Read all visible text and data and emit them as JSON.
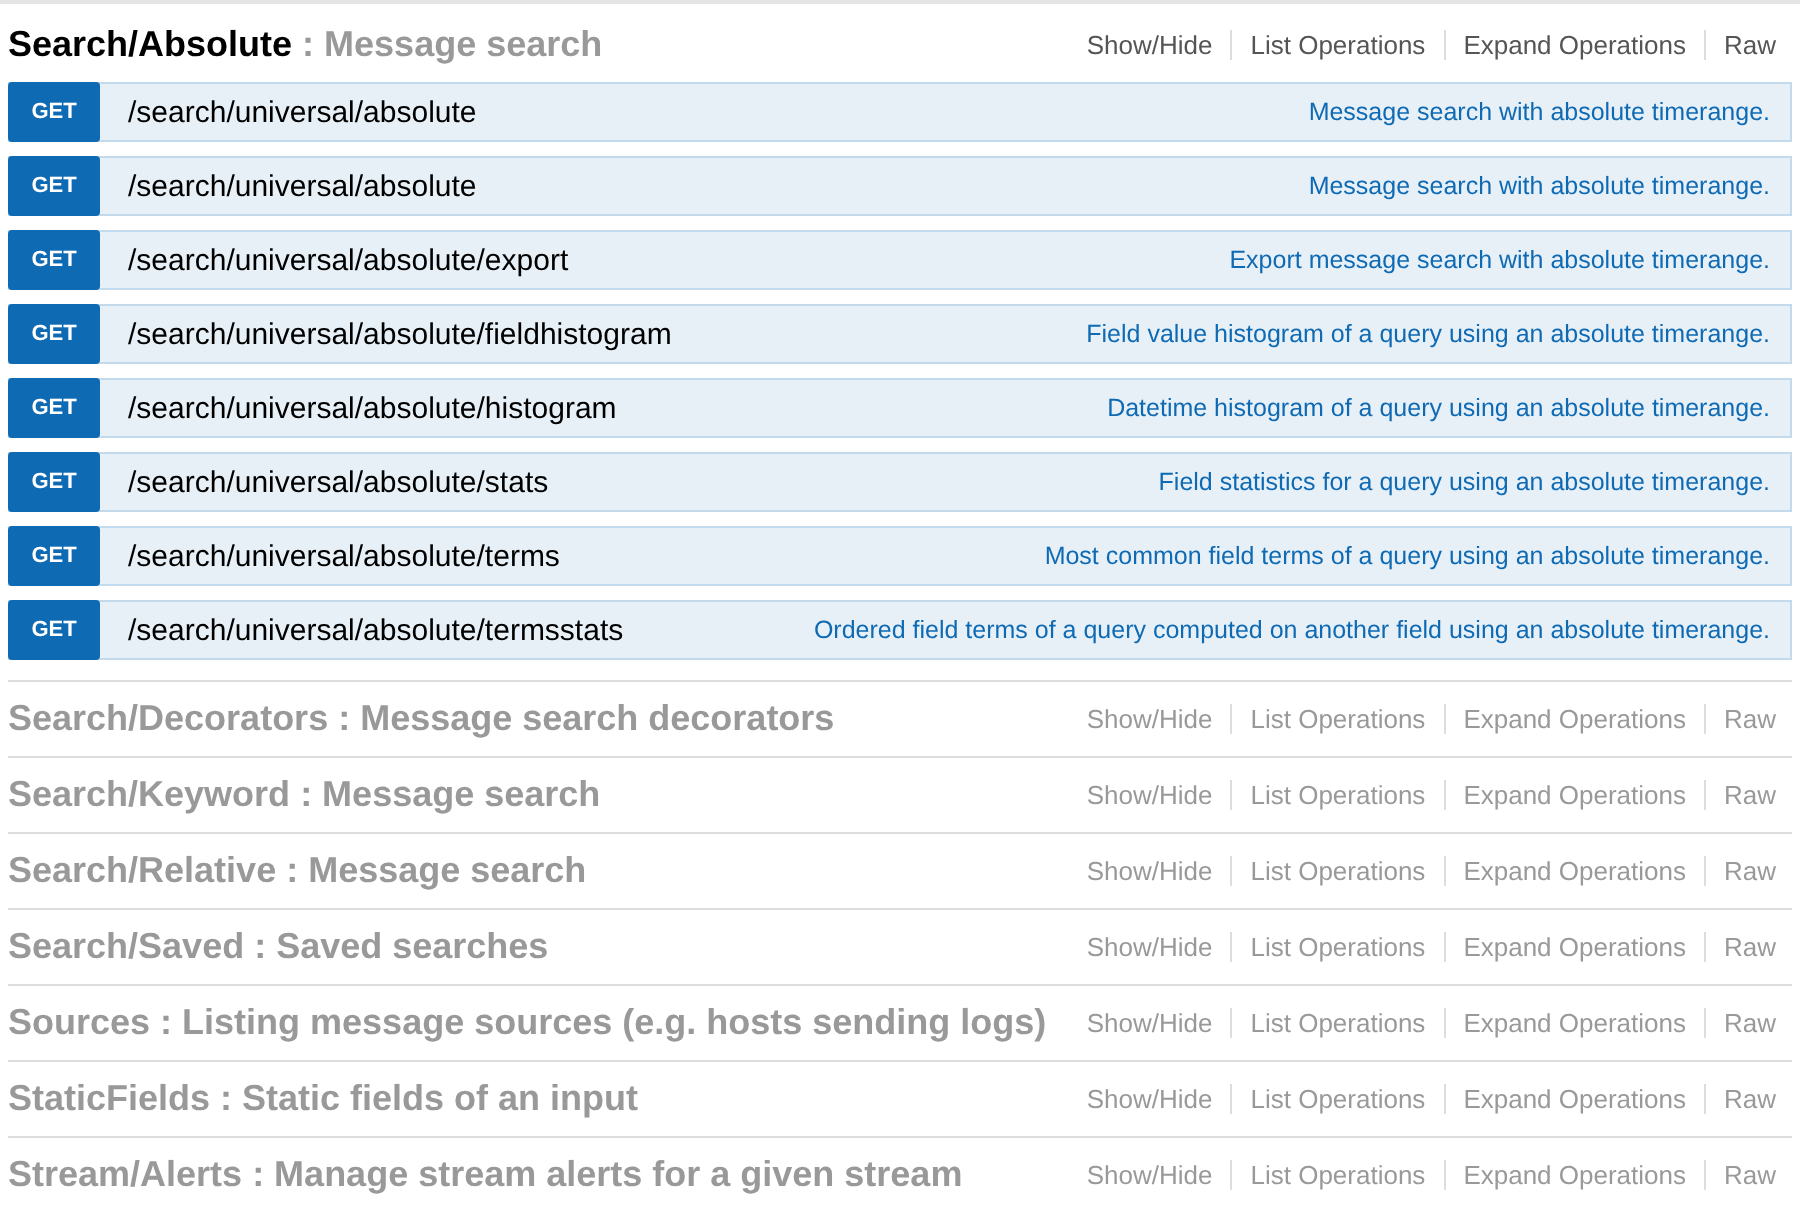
{
  "sections": [
    {
      "name": "Search/Absolute",
      "description": ": Message search",
      "expanded": true,
      "actions": [
        "Show/Hide",
        "List Operations",
        "Expand Operations",
        "Raw"
      ],
      "operations": [
        {
          "method": "GET",
          "path": "/search/universal/absolute",
          "summary": "Message search with absolute timerange."
        },
        {
          "method": "GET",
          "path": "/search/universal/absolute",
          "summary": "Message search with absolute timerange."
        },
        {
          "method": "GET",
          "path": "/search/universal/absolute/export",
          "summary": "Export message search with absolute timerange."
        },
        {
          "method": "GET",
          "path": "/search/universal/absolute/fieldhistogram",
          "summary": "Field value histogram of a query using an absolute timerange."
        },
        {
          "method": "GET",
          "path": "/search/universal/absolute/histogram",
          "summary": "Datetime histogram of a query using an absolute timerange."
        },
        {
          "method": "GET",
          "path": "/search/universal/absolute/stats",
          "summary": "Field statistics for a query using an absolute timerange."
        },
        {
          "method": "GET",
          "path": "/search/universal/absolute/terms",
          "summary": "Most common field terms of a query using an absolute timerange."
        },
        {
          "method": "GET",
          "path": "/search/universal/absolute/termsstats",
          "summary": "Ordered field terms of a query computed on another field using an absolute timerange."
        }
      ]
    },
    {
      "name": "Search/Decorators",
      "description": ": Message search decorators",
      "expanded": false,
      "actions": [
        "Show/Hide",
        "List Operations",
        "Expand Operations",
        "Raw"
      ]
    },
    {
      "name": "Search/Keyword",
      "description": ": Message search",
      "expanded": false,
      "actions": [
        "Show/Hide",
        "List Operations",
        "Expand Operations",
        "Raw"
      ]
    },
    {
      "name": "Search/Relative",
      "description": ": Message search",
      "expanded": false,
      "actions": [
        "Show/Hide",
        "List Operations",
        "Expand Operations",
        "Raw"
      ]
    },
    {
      "name": "Search/Saved",
      "description": ": Saved searches",
      "expanded": false,
      "actions": [
        "Show/Hide",
        "List Operations",
        "Expand Operations",
        "Raw"
      ]
    },
    {
      "name": "Sources",
      "description": ": Listing message sources (e.g. hosts sending logs)",
      "expanded": false,
      "actions": [
        "Show/Hide",
        "List Operations",
        "Expand Operations",
        "Raw"
      ]
    },
    {
      "name": "StaticFields",
      "description": ": Static fields of an input",
      "expanded": false,
      "actions": [
        "Show/Hide",
        "List Operations",
        "Expand Operations",
        "Raw"
      ]
    },
    {
      "name": "Stream/Alerts",
      "description": ": Manage stream alerts for a given stream",
      "expanded": false,
      "actions": [
        "Show/Hide",
        "List Operations",
        "Expand Operations",
        "Raw"
      ]
    }
  ]
}
